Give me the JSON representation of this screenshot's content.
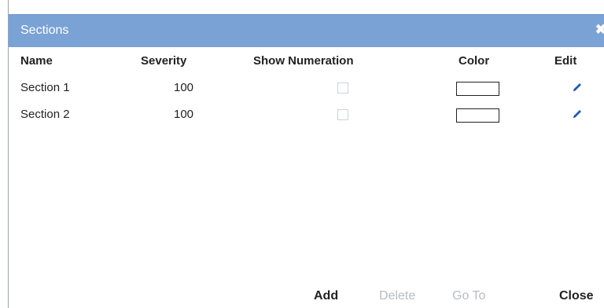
{
  "dialog": {
    "title": "Sections",
    "close_glyph": "✖"
  },
  "table": {
    "headers": {
      "name": "Name",
      "severity": "Severity",
      "show_numeration": "Show Numeration",
      "color": "Color",
      "edit": "Edit"
    },
    "rows": [
      {
        "name": "Section 1",
        "severity": "100",
        "show_numeration": false,
        "color": "#ffffff"
      },
      {
        "name": "Section 2",
        "severity": "100",
        "show_numeration": false,
        "color": "#ffffff"
      }
    ]
  },
  "footer": {
    "add": "Add",
    "delete": "Delete",
    "goto": "Go To",
    "close": "Close"
  },
  "colors": {
    "titlebar": "#7aa2d4",
    "disabled_text": "#b8bcc2",
    "edit_icon": "#1f5fae"
  },
  "icons": {
    "edit": "pencil-icon",
    "close": "close-icon"
  }
}
